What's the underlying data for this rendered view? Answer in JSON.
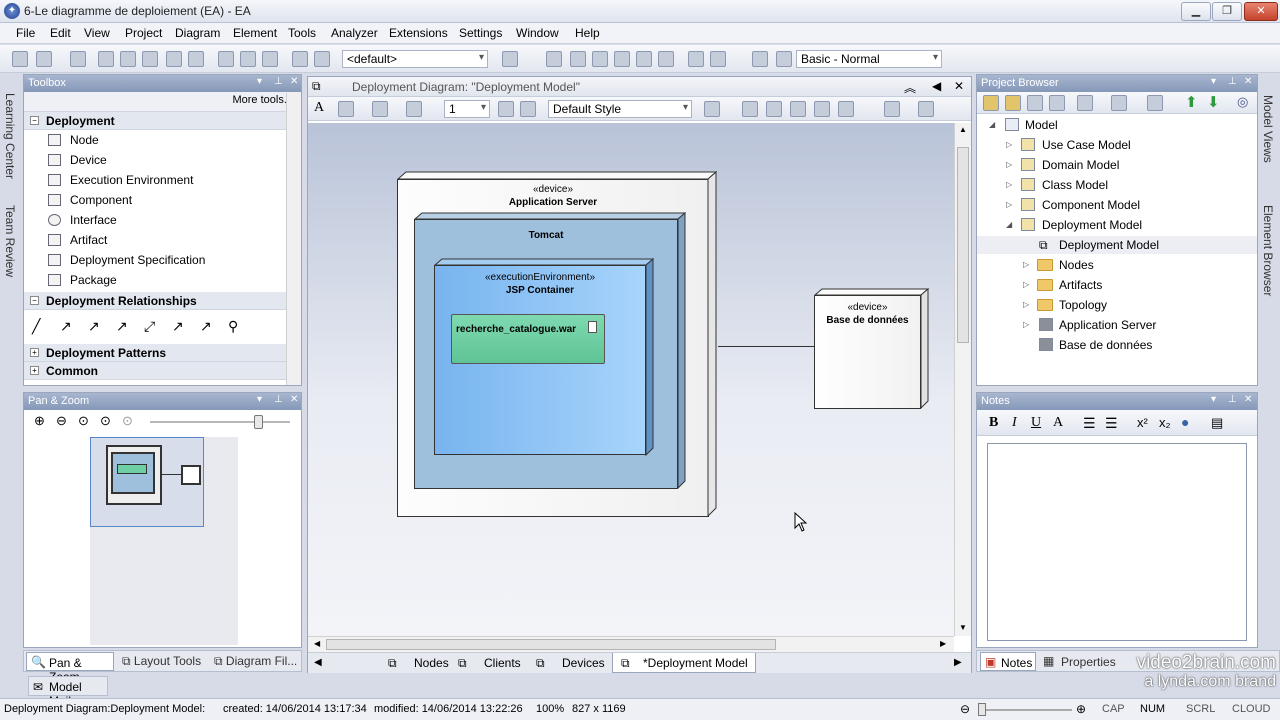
{
  "window": {
    "title": "6-Le diagramme de deploiement (EA) - EA"
  },
  "menu": [
    "File",
    "Edit",
    "View",
    "Project",
    "Diagram",
    "Element",
    "Tools",
    "Analyzer",
    "Extensions",
    "Settings",
    "Window",
    "Help"
  ],
  "toolbar": {
    "perspective": "<default>",
    "workspace": "Basic - Normal"
  },
  "toolbox": {
    "title": "Toolbox",
    "more_tools": "More tools...",
    "section_deployment": "Deployment",
    "items": [
      "Node",
      "Device",
      "Execution Environment",
      "Component",
      "Interface",
      "Artifact",
      "Deployment Specification",
      "Package"
    ],
    "section_relationships": "Deployment Relationships",
    "section_patterns": "Deployment Patterns",
    "section_common": "Common"
  },
  "pan_zoom": {
    "title": "Pan & Zoom"
  },
  "left_tabs": {
    "pan_zoom": "Pan & Zoom",
    "layout_tools": "Layout Tools",
    "diagram_filters": "Diagram Fil...",
    "model_mail": "Model Mail"
  },
  "side_tabs": {
    "learning": "Learning Center",
    "team": "Team Review",
    "model_views": "Model Views",
    "element_browser": "Element Browser"
  },
  "diagram": {
    "tab_title": "Deployment Diagram: \"Deployment Model\"",
    "line_width": "1",
    "style": "Default Style",
    "app_server": {
      "stereo": "«device»",
      "name": "Application Server"
    },
    "tomcat": {
      "name": "Tomcat"
    },
    "jsp": {
      "stereo": "«executionEnvironment»",
      "name": "JSP Container"
    },
    "artifact": {
      "name": "recherche_catalogue.war"
    },
    "db": {
      "stereo": "«device»",
      "name": "Base de données"
    },
    "tabs": [
      "Nodes",
      "Clients",
      "Devices",
      "*Deployment Model"
    ]
  },
  "project_browser": {
    "title": "Project Browser",
    "root": "Model",
    "items": [
      "Use Case Model",
      "Domain Model",
      "Class Model",
      "Component Model",
      "Deployment Model"
    ],
    "children": [
      "Deployment Model",
      "Nodes",
      "Artifacts",
      "Topology",
      "Application Server",
      "Base de données"
    ]
  },
  "notes": {
    "title": "Notes",
    "tab_notes": "Notes",
    "tab_properties": "Properties"
  },
  "watermark": {
    "line1": "video2brain.com",
    "line2": "a lynda.com brand"
  },
  "status": {
    "diagram": "Deployment Diagram:Deployment Model:",
    "created": "created: 14/06/2014 13:17:34",
    "modified": "modified: 14/06/2014 13:22:26",
    "zoom": "100%",
    "size": "827 x 1169",
    "caps": "CAP",
    "num": "NUM",
    "scrl": "SCRL",
    "cloud": "CLOUD"
  },
  "colors": {
    "accent": "#8598b8",
    "artifact": "#6fcfa4",
    "jsp": "#8fc4f2",
    "tomcat": "#9fc0dd"
  }
}
